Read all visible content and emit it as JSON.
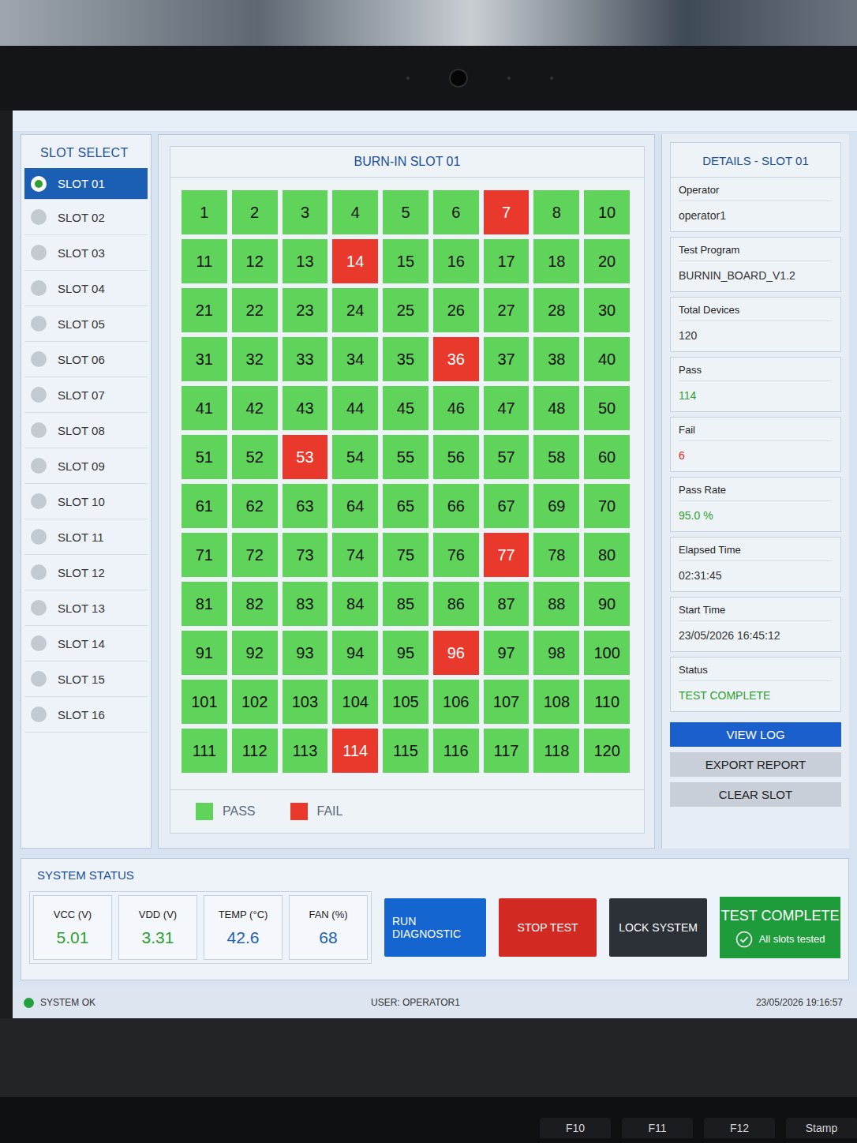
{
  "slot_select": {
    "title": "SLOT SELECT",
    "items": [
      {
        "label": "SLOT 01",
        "selected": true
      },
      {
        "label": "SLOT 02",
        "selected": false
      },
      {
        "label": "SLOT 03",
        "selected": false
      },
      {
        "label": "SLOT 04",
        "selected": false
      },
      {
        "label": "SLOT 05",
        "selected": false
      },
      {
        "label": "SLOT 06",
        "selected": false
      },
      {
        "label": "SLOT 07",
        "selected": false
      },
      {
        "label": "SLOT 08",
        "selected": false
      },
      {
        "label": "SLOT 09",
        "selected": false
      },
      {
        "label": "SLOT 10",
        "selected": false
      },
      {
        "label": "SLOT 11",
        "selected": false
      },
      {
        "label": "SLOT 12",
        "selected": false
      },
      {
        "label": "SLOT 13",
        "selected": false
      },
      {
        "label": "SLOT 14",
        "selected": false
      },
      {
        "label": "SLOT 15",
        "selected": false
      },
      {
        "label": "SLOT 16",
        "selected": false
      }
    ]
  },
  "burn_in": {
    "title": "BURN-IN SLOT 01",
    "cells": [
      {
        "label": "1",
        "failed": false
      },
      {
        "label": "2",
        "failed": false
      },
      {
        "label": "3",
        "failed": false
      },
      {
        "label": "4",
        "failed": false
      },
      {
        "label": "5",
        "failed": false
      },
      {
        "label": "6",
        "failed": false
      },
      {
        "label": "7",
        "failed": true
      },
      {
        "label": "8",
        "failed": false
      },
      {
        "label": "10",
        "failed": false
      },
      {
        "label": "11",
        "failed": false
      },
      {
        "label": "12",
        "failed": false
      },
      {
        "label": "13",
        "failed": false
      },
      {
        "label": "14",
        "failed": true
      },
      {
        "label": "15",
        "failed": false
      },
      {
        "label": "16",
        "failed": false
      },
      {
        "label": "17",
        "failed": false
      },
      {
        "label": "18",
        "failed": false
      },
      {
        "label": "20",
        "failed": false
      },
      {
        "label": "21",
        "failed": false
      },
      {
        "label": "22",
        "failed": false
      },
      {
        "label": "23",
        "failed": false
      },
      {
        "label": "24",
        "failed": false
      },
      {
        "label": "25",
        "failed": false
      },
      {
        "label": "26",
        "failed": false
      },
      {
        "label": "27",
        "failed": false
      },
      {
        "label": "28",
        "failed": false
      },
      {
        "label": "30",
        "failed": false
      },
      {
        "label": "31",
        "failed": false
      },
      {
        "label": "32",
        "failed": false
      },
      {
        "label": "33",
        "failed": false
      },
      {
        "label": "34",
        "failed": false
      },
      {
        "label": "35",
        "failed": false
      },
      {
        "label": "36",
        "failed": true
      },
      {
        "label": "37",
        "failed": false
      },
      {
        "label": "38",
        "failed": false
      },
      {
        "label": "40",
        "failed": false
      },
      {
        "label": "41",
        "failed": false
      },
      {
        "label": "42",
        "failed": false
      },
      {
        "label": "43",
        "failed": false
      },
      {
        "label": "44",
        "failed": false
      },
      {
        "label": "45",
        "failed": false
      },
      {
        "label": "46",
        "failed": false
      },
      {
        "label": "47",
        "failed": false
      },
      {
        "label": "48",
        "failed": false
      },
      {
        "label": "50",
        "failed": false
      },
      {
        "label": "51",
        "failed": false
      },
      {
        "label": "52",
        "failed": false
      },
      {
        "label": "53",
        "failed": true
      },
      {
        "label": "54",
        "failed": false
      },
      {
        "label": "55",
        "failed": false
      },
      {
        "label": "56",
        "failed": false
      },
      {
        "label": "57",
        "failed": false
      },
      {
        "label": "58",
        "failed": false
      },
      {
        "label": "60",
        "failed": false
      },
      {
        "label": "61",
        "failed": false
      },
      {
        "label": "62",
        "failed": false
      },
      {
        "label": "63",
        "failed": false
      },
      {
        "label": "64",
        "failed": false
      },
      {
        "label": "65",
        "failed": false
      },
      {
        "label": "66",
        "failed": false
      },
      {
        "label": "67",
        "failed": false
      },
      {
        "label": "69",
        "failed": false
      },
      {
        "label": "70",
        "failed": false
      },
      {
        "label": "71",
        "failed": false
      },
      {
        "label": "72",
        "failed": false
      },
      {
        "label": "73",
        "failed": false
      },
      {
        "label": "74",
        "failed": false
      },
      {
        "label": "75",
        "failed": false
      },
      {
        "label": "76",
        "failed": false
      },
      {
        "label": "77",
        "failed": true
      },
      {
        "label": "78",
        "failed": false
      },
      {
        "label": "80",
        "failed": false
      },
      {
        "label": "81",
        "failed": false
      },
      {
        "label": "82",
        "failed": false
      },
      {
        "label": "83",
        "failed": false
      },
      {
        "label": "84",
        "failed": false
      },
      {
        "label": "85",
        "failed": false
      },
      {
        "label": "86",
        "failed": false
      },
      {
        "label": "87",
        "failed": false
      },
      {
        "label": "88",
        "failed": false
      },
      {
        "label": "90",
        "failed": false
      },
      {
        "label": "91",
        "failed": false
      },
      {
        "label": "92",
        "failed": false
      },
      {
        "label": "93",
        "failed": false
      },
      {
        "label": "94",
        "failed": false
      },
      {
        "label": "95",
        "failed": false
      },
      {
        "label": "96",
        "failed": true
      },
      {
        "label": "97",
        "failed": false
      },
      {
        "label": "98",
        "failed": false
      },
      {
        "label": "100",
        "failed": false
      },
      {
        "label": "101",
        "failed": false
      },
      {
        "label": "102",
        "failed": false
      },
      {
        "label": "103",
        "failed": false
      },
      {
        "label": "104",
        "failed": false
      },
      {
        "label": "105",
        "failed": false
      },
      {
        "label": "106",
        "failed": false
      },
      {
        "label": "107",
        "failed": false
      },
      {
        "label": "108",
        "failed": false
      },
      {
        "label": "110",
        "failed": false
      },
      {
        "label": "111",
        "failed": false
      },
      {
        "label": "112",
        "failed": false
      },
      {
        "label": "113",
        "failed": false
      },
      {
        "label": "114",
        "failed": true
      },
      {
        "label": "115",
        "failed": false
      },
      {
        "label": "116",
        "failed": false
      },
      {
        "label": "117",
        "failed": false
      },
      {
        "label": "118",
        "failed": false
      },
      {
        "label": "120",
        "failed": false
      }
    ],
    "legend": [
      {
        "label": "PASS",
        "color": "#5fd35a"
      },
      {
        "label": "FAIL",
        "color": "#e8392c"
      }
    ]
  },
  "details": {
    "title": "DETAILS - SLOT 01",
    "fields": [
      {
        "label": "Operator",
        "value": "operator1",
        "color": "#333333"
      },
      {
        "label": "Test Program",
        "value": "BURNIN_BOARD_V1.2",
        "color": "#333333"
      },
      {
        "label": "Total Devices",
        "value": "120",
        "color": "#333333"
      },
      {
        "label": "Pass",
        "value": "114",
        "color": "#2ea02e"
      },
      {
        "label": "Fail",
        "value": "6",
        "color": "#e0281e"
      },
      {
        "label": "Pass Rate",
        "value": "95.0 %",
        "color": "#2ea02e"
      },
      {
        "label": "Elapsed Time",
        "value": "02:31:45",
        "color": "#333333"
      },
      {
        "label": "Start Time",
        "value": "23/05/2026 16:45:12",
        "color": "#333333"
      },
      {
        "label": "Status",
        "value": "TEST COMPLETE",
        "color": "#2ea02e"
      }
    ],
    "buttons": [
      {
        "label": "VIEW LOG",
        "kind": "primary"
      },
      {
        "label": "EXPORT REPORT",
        "kind": "secondary"
      },
      {
        "label": "CLEAR SLOT",
        "kind": "secondary"
      }
    ]
  },
  "system_status": {
    "title": "SYSTEM STATUS",
    "metrics": [
      {
        "label": "VCC (V)",
        "value": "5.01",
        "color": "#2ea02e"
      },
      {
        "label": "VDD (V)",
        "value": "3.31",
        "color": "#2ea02e"
      },
      {
        "label": "TEMP (°C)",
        "value": "42.6",
        "color": "#1e5fb4"
      },
      {
        "label": "FAN (%)",
        "value": "68",
        "color": "#1e5fb4"
      }
    ],
    "buttons": [
      {
        "label": "RUN DIAGNOSTIC",
        "color": "#1565d0"
      },
      {
        "label": "STOP TEST",
        "color": "#d22a22"
      },
      {
        "label": "LOCK SYSTEM",
        "color": "#2c3138"
      }
    ],
    "summary": {
      "title": "TEST COMPLETE",
      "subtitle": "All slots tested"
    }
  },
  "status_bar": {
    "status": "SYSTEM OK",
    "user": "USER: OPERATOR1",
    "datetime": "23/05/2026 19:16:57"
  },
  "keyboard": {
    "keys": [
      "F10",
      "F11",
      "F12",
      "Stamp"
    ]
  }
}
